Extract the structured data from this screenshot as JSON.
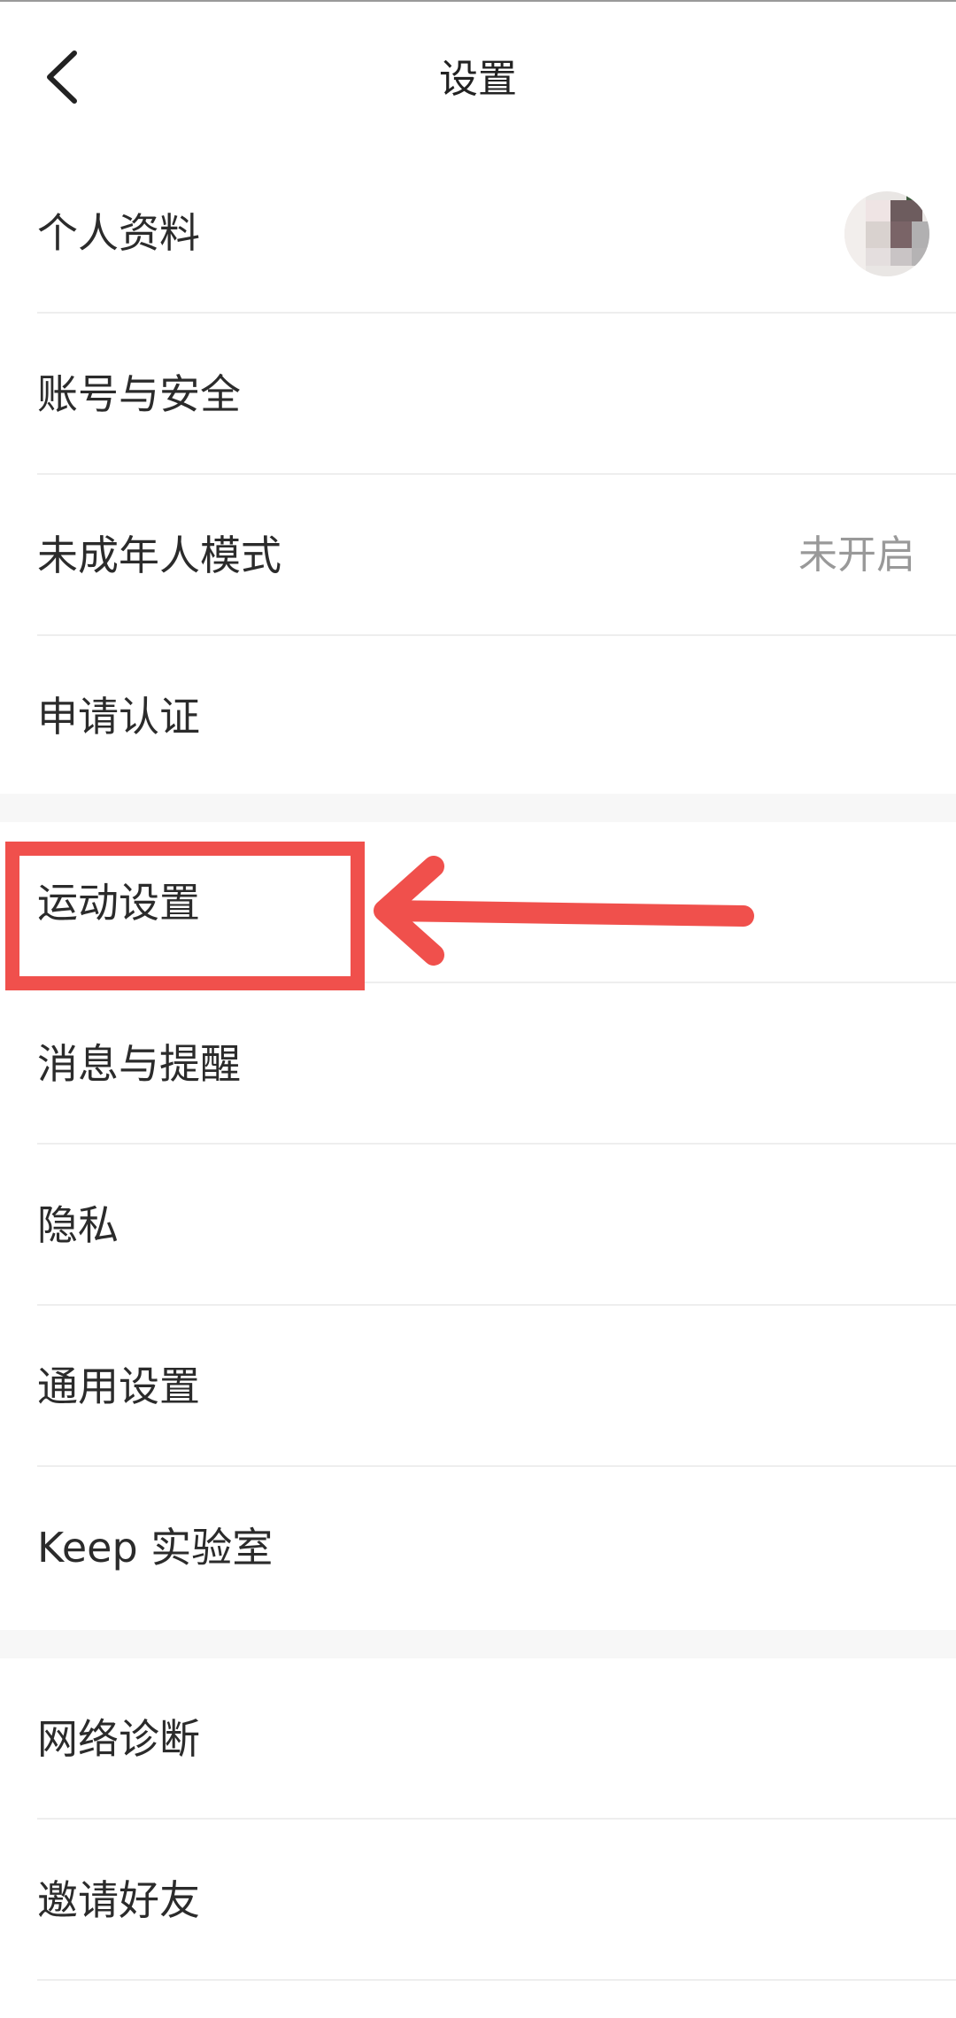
{
  "header": {
    "title": "设置",
    "back_icon": "chevron-left-icon"
  },
  "sections": [
    {
      "items": [
        {
          "label": "个人资料",
          "value": "",
          "avatar": true
        },
        {
          "label": "账号与安全",
          "value": ""
        },
        {
          "label": "未成年人模式",
          "value": "未开启"
        },
        {
          "label": "申请认证",
          "value": ""
        }
      ]
    },
    {
      "items": [
        {
          "label": "运动设置",
          "value": ""
        },
        {
          "label": "消息与提醒",
          "value": ""
        },
        {
          "label": "隐私",
          "value": ""
        },
        {
          "label": "通用设置",
          "value": ""
        },
        {
          "label": "Keep 实验室",
          "value": ""
        }
      ]
    },
    {
      "items": [
        {
          "label": "网络诊断",
          "value": ""
        },
        {
          "label": "邀请好友",
          "value": ""
        }
      ]
    }
  ],
  "annotation": {
    "highlight_color": "#f0504c",
    "highlighted_item": "运动设置",
    "pointer_icon": "arrow-left-icon"
  },
  "colors": {
    "background": "#f7f7f7",
    "card": "#ffffff",
    "text": "#2b2b2b",
    "secondary_text": "#999999"
  }
}
